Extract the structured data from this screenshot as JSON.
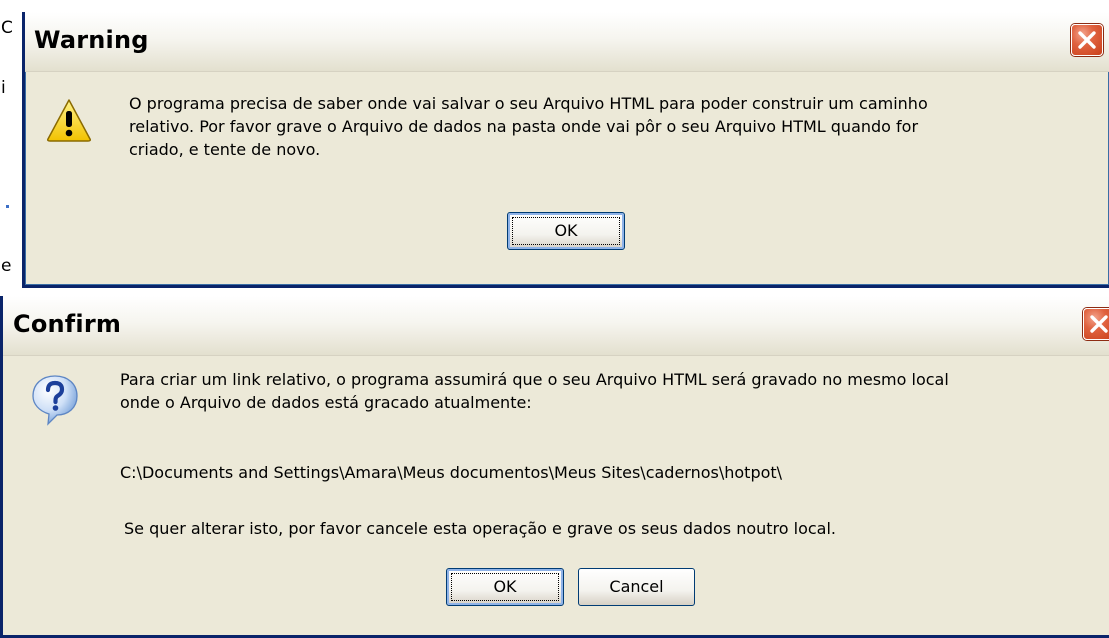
{
  "background": {
    "fragments": [
      "C",
      "i",
      "e"
    ]
  },
  "dialogs": {
    "warning": {
      "title": "Warning",
      "icon": "warning-icon",
      "message": "O programa precisa de saber onde vai salvar o seu Arquivo HTML para poder construir um caminho\nrelativo. Por favor grave o Arquivo de dados na pasta onde vai pôr o seu Arquivo HTML quando for\ncriado, e tente de novo.",
      "buttons": {
        "ok": "OK"
      }
    },
    "confirm": {
      "title": "Confirm",
      "icon": "question-icon",
      "message_intro": "Para criar um link relativo, o programa assumirá que o seu Arquivo HTML será gravado no mesmo local\nonde o Arquivo de dados está gracado atualmente:",
      "path": "C:\\Documents and Settings\\Amara\\Meus documentos\\Meus Sites\\cadernos\\hotpot\\",
      "message_outro": "Se quer alterar isto, por favor cancele esta operação e grave os seus dados noutro local.",
      "buttons": {
        "ok": "OK",
        "cancel": "Cancel"
      }
    }
  },
  "colors": {
    "dialog_face": "#ece9d8",
    "frame": "#0a246a",
    "close_red": "#c9401b"
  }
}
